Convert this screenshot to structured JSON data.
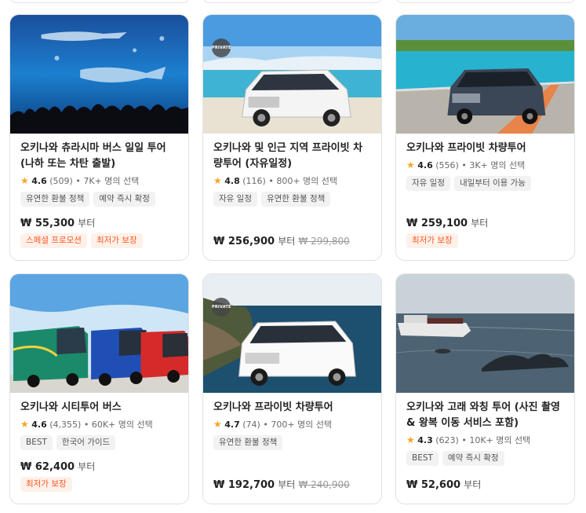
{
  "products": [
    {
      "title": "오키나와 츄라시마 버스 일일 투어 (나하 또는 차탄 출발)",
      "rating": "4.6",
      "reviews": "(509)",
      "booked": "7K+ 명의 선택",
      "tags": [
        "유연한 환불 정책",
        "예약 즉시 확정"
      ],
      "price": "₩ 55,300",
      "price_suffix": "부터",
      "original_price": "",
      "promos": [
        "스페셜 프로모션",
        "최저가 보장"
      ]
    },
    {
      "title": "오키나와 및 인근 지역 프라이빗 차량투어 (자유일정)",
      "rating": "4.8",
      "reviews": "(116)",
      "booked": "800+ 명의 선택",
      "tags": [
        "자유 일정",
        "유연한 환불 정책"
      ],
      "price": "₩ 256,900",
      "price_suffix": "부터",
      "original_price": "₩ 299,800",
      "promos": [],
      "badge": "PRIVATE"
    },
    {
      "title": "오키나와 프라이빗 차량투어",
      "rating": "4.6",
      "reviews": "(556)",
      "booked": "3K+ 명의 선택",
      "tags": [
        "자유 일정",
        "내일부터 이용 가능"
      ],
      "price": "₩ 259,100",
      "price_suffix": "부터",
      "original_price": "",
      "promos": [
        "최저가 보장"
      ]
    },
    {
      "title": "오키나와 시티투어 버스",
      "rating": "4.6",
      "reviews": "(4,355)",
      "booked": "60K+ 명의 선택",
      "tags": [
        "BEST",
        "한국어 가이드"
      ],
      "price": "₩ 62,400",
      "price_suffix": "부터",
      "original_price": "",
      "promos": [
        "최저가 보장"
      ]
    },
    {
      "title": "오키나와 프라이빗 차량투어",
      "rating": "4.7",
      "reviews": "(74)",
      "booked": "700+ 명의 선택",
      "tags": [
        "유연한 환불 정책"
      ],
      "price": "₩ 192,700",
      "price_suffix": "부터",
      "original_price": "₩ 240,900",
      "promos": [],
      "badge": "PRIVATE"
    },
    {
      "title": "오키나와 고래 와칭 투어 (사진 촬영 & 왕복 이동 서비스 포함)",
      "rating": "4.3",
      "reviews": "(623)",
      "booked": "10K+ 명의 선택",
      "tags": [
        "BEST",
        "예약 즉시 확정"
      ],
      "price": "₩ 52,600",
      "price_suffix": "부터",
      "original_price": "",
      "promos": []
    }
  ],
  "colors": {
    "star": "#f5a623",
    "promo_text": "#ff5722",
    "promo_bg": "#fff1e9",
    "tag_bg": "#f2f2f2"
  },
  "icons": {
    "star": "star-icon"
  }
}
